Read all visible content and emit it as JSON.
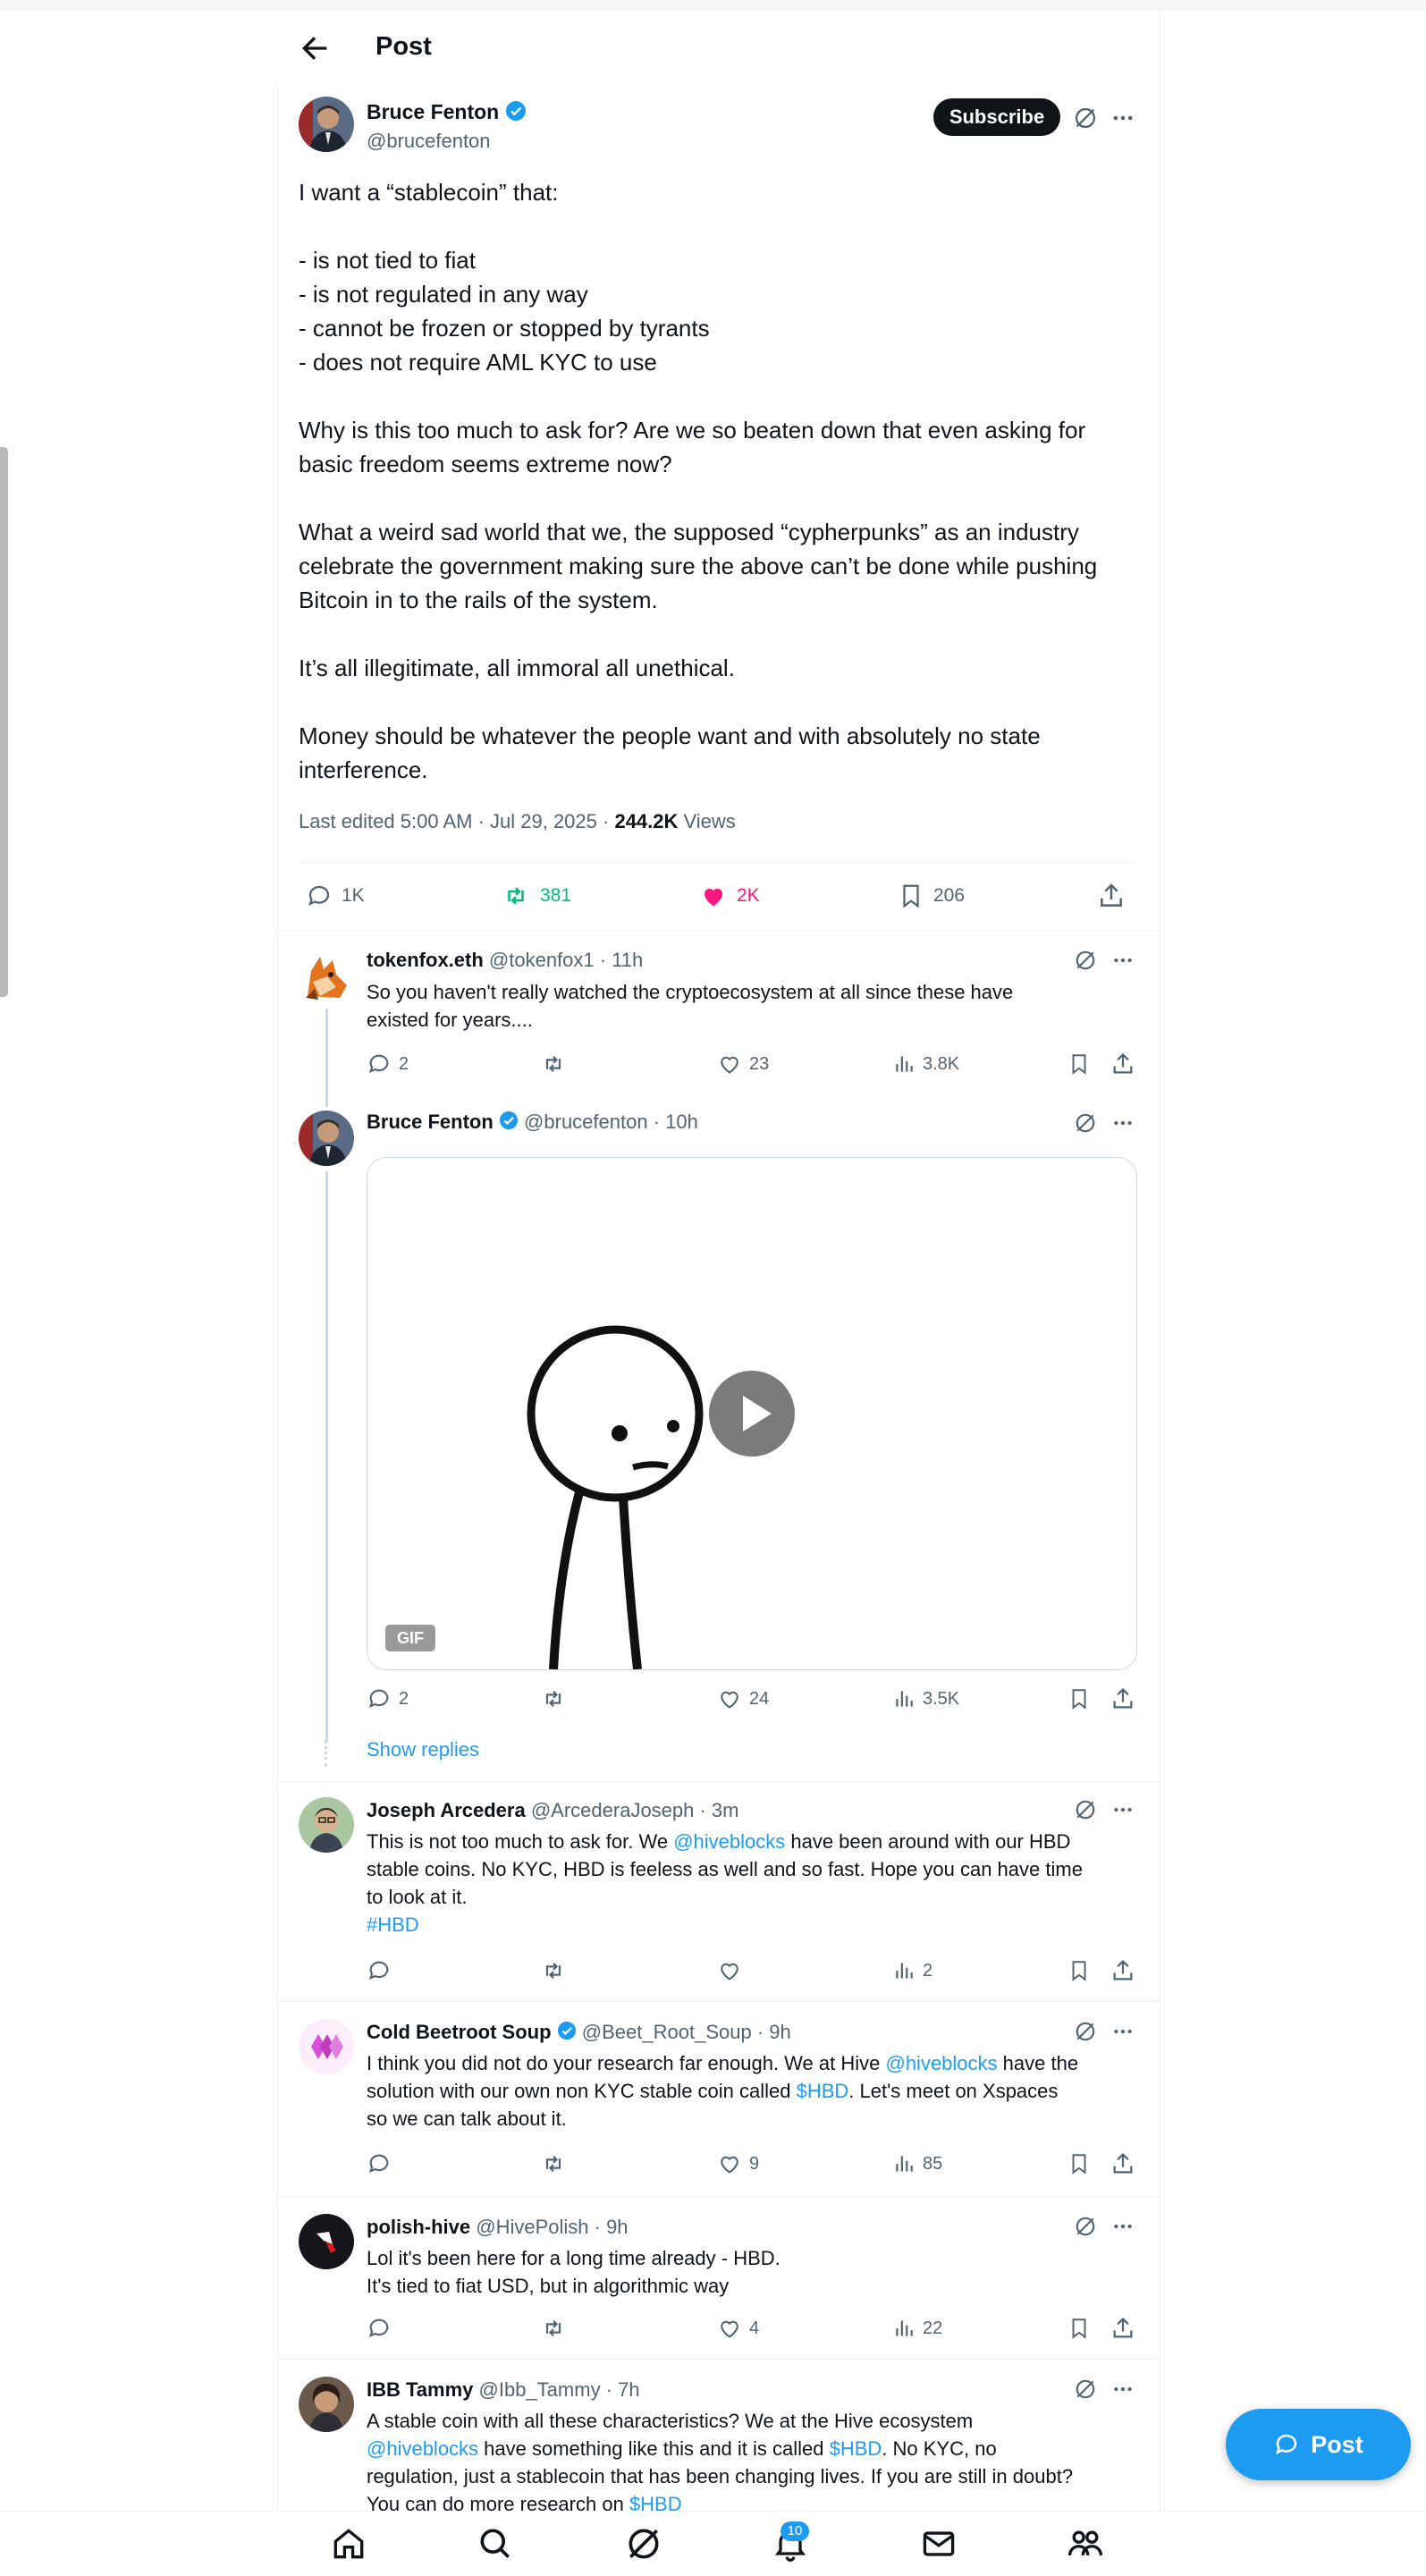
{
  "header": {
    "title": "Post"
  },
  "main_post": {
    "author": "Bruce Fenton",
    "handle": "@brucefenton",
    "subscribe_label": "Subscribe",
    "lines": [
      "I want a “stablecoin” that:",
      "",
      "- is not tied to fiat",
      "- is not regulated in any way",
      "- cannot be frozen or stopped by tyrants",
      "- does not require AML KYC to use",
      "",
      "Why is this too much to ask for?  Are we so beaten down that even asking for",
      "basic freedom seems extreme now?",
      "",
      "What a weird sad world that we, the supposed “cypherpunks” as an industry",
      "celebrate the government making sure the above can’t be done while pushing",
      "Bitcoin in to the rails of the system.",
      "",
      "It’s all illegitimate, all immoral all unethical.",
      "",
      "Money should be whatever the people want and with absolutely no state",
      "interference."
    ],
    "meta": {
      "edited": "Last edited 5:00 AM · Jul 29, 2025 · ",
      "views_count": "244.2K",
      "views_label": " Views"
    },
    "actions": {
      "replies": "1K",
      "reposts": "381",
      "likes": "2K",
      "bookmarks": "206"
    },
    "colors": {
      "repost": "#00ba7c",
      "like": "#f91880"
    }
  },
  "replies": [
    {
      "name": "tokenfox.eth",
      "handle": "@tokenfox1 · 11h",
      "text": [
        "So you haven't really watched the cryptoecosystem at all since these have",
        "existed for years...."
      ],
      "actions": {
        "replies": "2",
        "reposts": "",
        "likes": "23",
        "views": "3.8K"
      }
    },
    {
      "name": "Bruce Fenton",
      "handle": "@brucefenton · 10h",
      "media_badge": "GIF",
      "actions": {
        "replies": "2",
        "reposts": "",
        "likes": "24",
        "views": "3.5K"
      },
      "show_replies": "Show replies"
    },
    {
      "name": "Joseph Arcedera",
      "handle": "@ArcederaJoseph · 3m",
      "text_a": "This is not too much to ask for. We ",
      "mention": "@hiveblocks",
      "text_b": " have been around with our HBD",
      "text_c": "stable coins. No KYC, HBD is feeless as well and so fast. Hope you can have time",
      "text_d": "to look at it.",
      "hashtag": "#HBD",
      "actions": {
        "replies": "",
        "reposts": "",
        "likes": "",
        "views": "2"
      }
    },
    {
      "name": "Cold Beetroot Soup",
      "handle": "@Beet_Root_Soup · 9h",
      "text_a": "I think you did not do your research far enough. We at Hive ",
      "mention": "@hiveblocks",
      "text_b": " have the",
      "text_c": "solution with our own non KYC stable coin called ",
      "cashtag": "$HBD",
      "text_d": ". Let's meet on Xspaces",
      "text_e": "so we can talk about it.",
      "actions": {
        "replies": "",
        "reposts": "",
        "likes": "9",
        "views": "85"
      }
    },
    {
      "name": "polish-hive",
      "handle": "@HivePolish · 9h",
      "text": [
        "Lol it's been here for a long time already - HBD.",
        "It's tied to fiat USD, but in algorithmic way"
      ],
      "actions": {
        "replies": "",
        "reposts": "",
        "likes": "4",
        "views": "22"
      }
    },
    {
      "name": "IBB Tammy",
      "handle": "@Ibb_Tammy · 7h",
      "text_a": "A stable coin with all these characteristics? We at the Hive ecosystem",
      "mention": "@hiveblocks",
      "text_b": " have something like this and it is called ",
      "cashtag": "$HBD",
      "text_c": ". No KYC, no",
      "text_d": "regulation, just a stablecoin that has been changing lives.  If you are still in doubt?",
      "text_e": "You can do more research on ",
      "cashtag2": "$HBD"
    }
  ],
  "fab": {
    "label": "Post"
  },
  "nav": {
    "notifications_count": "10"
  }
}
